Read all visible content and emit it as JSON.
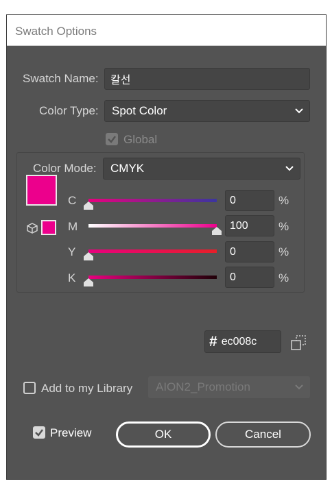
{
  "window": {
    "title": "Swatch Options"
  },
  "swatch_name": {
    "label": "Swatch Name:",
    "value": "칼선"
  },
  "color_type": {
    "label": "Color Type:",
    "value": "Spot Color"
  },
  "global": {
    "label": "Global",
    "checked": true,
    "enabled": false
  },
  "color_mode": {
    "label": "Color Mode:",
    "value": "CMYK"
  },
  "channels": [
    {
      "letter": "C",
      "value": "0",
      "unit": "%",
      "level": 0
    },
    {
      "letter": "M",
      "value": "100",
      "unit": "%",
      "level": 1
    },
    {
      "letter": "Y",
      "value": "0",
      "unit": "%",
      "level": 0
    },
    {
      "letter": "K",
      "value": "0",
      "unit": "%",
      "level": 0
    }
  ],
  "hex": {
    "symbol": "#",
    "value": "ec008c"
  },
  "swatch_color": "#ec008c",
  "library": {
    "label": "Add to my Library",
    "checked": false,
    "value": "AION2_Promotion"
  },
  "preview": {
    "label": "Preview",
    "checked": true
  },
  "buttons": {
    "ok": "OK",
    "cancel": "Cancel"
  },
  "icons": {
    "chevron": "chevron-down-icon",
    "cube": "cube-icon",
    "picker": "color-picker-icon",
    "check": "check-icon"
  }
}
